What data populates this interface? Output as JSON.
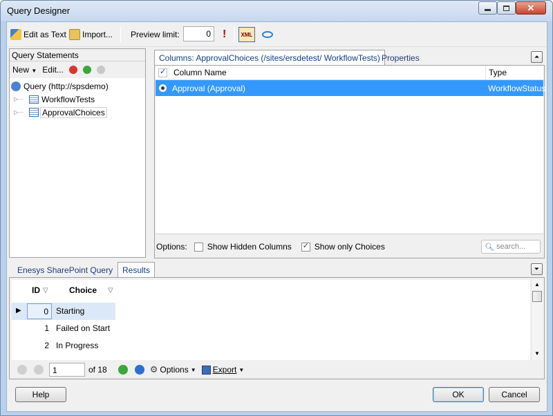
{
  "window": {
    "title": "Query Designer"
  },
  "toolbar": {
    "edit_as_text": "Edit as Text",
    "import": "Import...",
    "preview_label": "Preview limit:",
    "preview_value": "0"
  },
  "left": {
    "header": "Query Statements",
    "new": "New",
    "edit": "Edit...",
    "tree": [
      {
        "label": "Query (http://spsdemo)"
      },
      {
        "label": "WorkflowTests"
      },
      {
        "label": "ApprovalChoices"
      }
    ]
  },
  "right": {
    "tabs": [
      "Columns: ApprovalChoices (/sites/ersdetest/ WorkflowTests)",
      "Properties"
    ],
    "columns": [
      "Column Name",
      "Type"
    ],
    "rows": [
      {
        "name": "Approval (Approval)",
        "type": "WorkflowStatus"
      }
    ],
    "options_label": "Options:",
    "show_hidden": "Show Hidden Columns",
    "show_only": "Show only Choices",
    "search_placeholder": "search...",
    "show_hidden_checked": false,
    "show_only_checked": true
  },
  "bottom": {
    "tabs": [
      "Enesys SharePoint Query",
      "Results"
    ],
    "headers": [
      "ID",
      "Choice"
    ],
    "rows": [
      {
        "id": "0",
        "choice": "Starting"
      },
      {
        "id": "1",
        "choice": "Failed on Start"
      },
      {
        "id": "2",
        "choice": "In Progress"
      }
    ],
    "page": "1",
    "of": "of 18",
    "options": "Options",
    "export": "Export"
  },
  "buttons": {
    "help": "Help",
    "ok": "OK",
    "cancel": "Cancel"
  }
}
